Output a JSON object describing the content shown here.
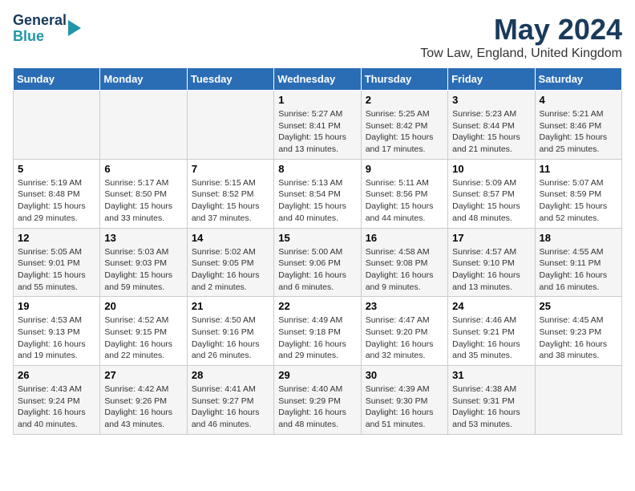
{
  "logo": {
    "line1": "General",
    "line2": "Blue"
  },
  "title": "May 2024",
  "subtitle": "Tow Law, England, United Kingdom",
  "headers": [
    "Sunday",
    "Monday",
    "Tuesday",
    "Wednesday",
    "Thursday",
    "Friday",
    "Saturday"
  ],
  "weeks": [
    [
      {
        "day": "",
        "info": ""
      },
      {
        "day": "",
        "info": ""
      },
      {
        "day": "",
        "info": ""
      },
      {
        "day": "1",
        "info": "Sunrise: 5:27 AM\nSunset: 8:41 PM\nDaylight: 15 hours\nand 13 minutes."
      },
      {
        "day": "2",
        "info": "Sunrise: 5:25 AM\nSunset: 8:42 PM\nDaylight: 15 hours\nand 17 minutes."
      },
      {
        "day": "3",
        "info": "Sunrise: 5:23 AM\nSunset: 8:44 PM\nDaylight: 15 hours\nand 21 minutes."
      },
      {
        "day": "4",
        "info": "Sunrise: 5:21 AM\nSunset: 8:46 PM\nDaylight: 15 hours\nand 25 minutes."
      }
    ],
    [
      {
        "day": "5",
        "info": "Sunrise: 5:19 AM\nSunset: 8:48 PM\nDaylight: 15 hours\nand 29 minutes."
      },
      {
        "day": "6",
        "info": "Sunrise: 5:17 AM\nSunset: 8:50 PM\nDaylight: 15 hours\nand 33 minutes."
      },
      {
        "day": "7",
        "info": "Sunrise: 5:15 AM\nSunset: 8:52 PM\nDaylight: 15 hours\nand 37 minutes."
      },
      {
        "day": "8",
        "info": "Sunrise: 5:13 AM\nSunset: 8:54 PM\nDaylight: 15 hours\nand 40 minutes."
      },
      {
        "day": "9",
        "info": "Sunrise: 5:11 AM\nSunset: 8:56 PM\nDaylight: 15 hours\nand 44 minutes."
      },
      {
        "day": "10",
        "info": "Sunrise: 5:09 AM\nSunset: 8:57 PM\nDaylight: 15 hours\nand 48 minutes."
      },
      {
        "day": "11",
        "info": "Sunrise: 5:07 AM\nSunset: 8:59 PM\nDaylight: 15 hours\nand 52 minutes."
      }
    ],
    [
      {
        "day": "12",
        "info": "Sunrise: 5:05 AM\nSunset: 9:01 PM\nDaylight: 15 hours\nand 55 minutes."
      },
      {
        "day": "13",
        "info": "Sunrise: 5:03 AM\nSunset: 9:03 PM\nDaylight: 15 hours\nand 59 minutes."
      },
      {
        "day": "14",
        "info": "Sunrise: 5:02 AM\nSunset: 9:05 PM\nDaylight: 16 hours\nand 2 minutes."
      },
      {
        "day": "15",
        "info": "Sunrise: 5:00 AM\nSunset: 9:06 PM\nDaylight: 16 hours\nand 6 minutes."
      },
      {
        "day": "16",
        "info": "Sunrise: 4:58 AM\nSunset: 9:08 PM\nDaylight: 16 hours\nand 9 minutes."
      },
      {
        "day": "17",
        "info": "Sunrise: 4:57 AM\nSunset: 9:10 PM\nDaylight: 16 hours\nand 13 minutes."
      },
      {
        "day": "18",
        "info": "Sunrise: 4:55 AM\nSunset: 9:11 PM\nDaylight: 16 hours\nand 16 minutes."
      }
    ],
    [
      {
        "day": "19",
        "info": "Sunrise: 4:53 AM\nSunset: 9:13 PM\nDaylight: 16 hours\nand 19 minutes."
      },
      {
        "day": "20",
        "info": "Sunrise: 4:52 AM\nSunset: 9:15 PM\nDaylight: 16 hours\nand 22 minutes."
      },
      {
        "day": "21",
        "info": "Sunrise: 4:50 AM\nSunset: 9:16 PM\nDaylight: 16 hours\nand 26 minutes."
      },
      {
        "day": "22",
        "info": "Sunrise: 4:49 AM\nSunset: 9:18 PM\nDaylight: 16 hours\nand 29 minutes."
      },
      {
        "day": "23",
        "info": "Sunrise: 4:47 AM\nSunset: 9:20 PM\nDaylight: 16 hours\nand 32 minutes."
      },
      {
        "day": "24",
        "info": "Sunrise: 4:46 AM\nSunset: 9:21 PM\nDaylight: 16 hours\nand 35 minutes."
      },
      {
        "day": "25",
        "info": "Sunrise: 4:45 AM\nSunset: 9:23 PM\nDaylight: 16 hours\nand 38 minutes."
      }
    ],
    [
      {
        "day": "26",
        "info": "Sunrise: 4:43 AM\nSunset: 9:24 PM\nDaylight: 16 hours\nand 40 minutes."
      },
      {
        "day": "27",
        "info": "Sunrise: 4:42 AM\nSunset: 9:26 PM\nDaylight: 16 hours\nand 43 minutes."
      },
      {
        "day": "28",
        "info": "Sunrise: 4:41 AM\nSunset: 9:27 PM\nDaylight: 16 hours\nand 46 minutes."
      },
      {
        "day": "29",
        "info": "Sunrise: 4:40 AM\nSunset: 9:29 PM\nDaylight: 16 hours\nand 48 minutes."
      },
      {
        "day": "30",
        "info": "Sunrise: 4:39 AM\nSunset: 9:30 PM\nDaylight: 16 hours\nand 51 minutes."
      },
      {
        "day": "31",
        "info": "Sunrise: 4:38 AM\nSunset: 9:31 PM\nDaylight: 16 hours\nand 53 minutes."
      },
      {
        "day": "",
        "info": ""
      }
    ]
  ]
}
